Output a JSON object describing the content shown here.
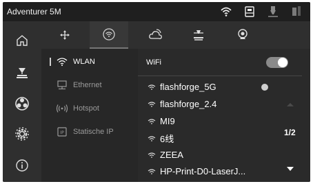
{
  "statusbar": {
    "title": "Adventurer 5M",
    "icons": [
      "wifi-status-icon",
      "usb-drive-icon",
      "nozzle-icon",
      "filament-icon"
    ]
  },
  "leftnav": {
    "items": [
      "home-icon",
      "build-plate-icon",
      "fan-icon",
      "settings-icon",
      "info-icon"
    ]
  },
  "topbar": {
    "tabs": [
      "move-axes-icon",
      "network-icon",
      "cloud-icon",
      "printer-icon",
      "camera-icon"
    ],
    "active_tab": "network-icon"
  },
  "submenu": {
    "items": [
      {
        "label": "WLAN",
        "icon": "wifi-icon",
        "active": true
      },
      {
        "label": "Ethernet",
        "icon": "ethernet-icon",
        "active": false
      },
      {
        "label": "Hotspot",
        "icon": "hotspot-icon",
        "active": false
      },
      {
        "label": "Statische IP",
        "icon": "ip-icon",
        "active": false
      }
    ]
  },
  "wifi": {
    "label": "WiFi",
    "enabled": true,
    "networks": [
      {
        "ssid": "flashforge_5G",
        "connected": true
      },
      {
        "ssid": "flashforge_2.4",
        "connected": false
      },
      {
        "ssid": "MI9",
        "connected": false
      },
      {
        "ssid": "6线",
        "connected": false
      },
      {
        "ssid": "ZEEA",
        "connected": false
      },
      {
        "ssid": "HP-Print-D0-LaserJ...",
        "connected": false
      }
    ],
    "page": "1/2"
  },
  "colors": {
    "background": "#2a2a2a",
    "panel": "#2f2f2f",
    "text": "#ffffff",
    "muted": "#9a9a9a"
  }
}
